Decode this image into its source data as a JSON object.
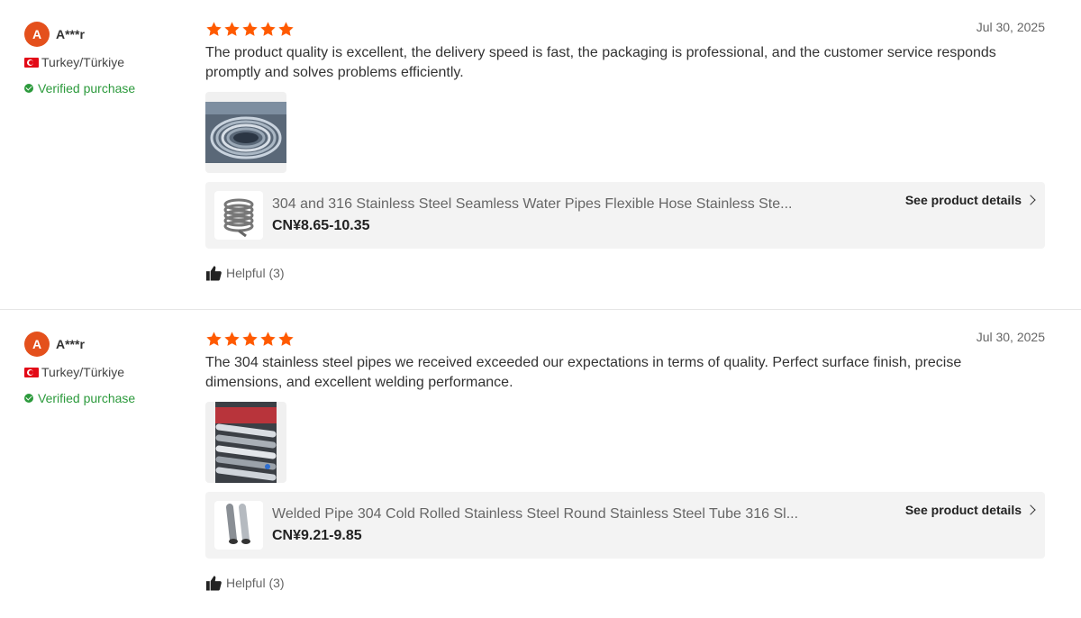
{
  "colors": {
    "star": "#ff5a00",
    "verified": "#2c9a3c",
    "avatar": "#e4501c"
  },
  "reviews": [
    {
      "avatar_letter": "A",
      "username": "A***r",
      "country": "Turkey/Türkiye",
      "verified_label": "Verified purchase",
      "rating": 5,
      "date": "Jul 30, 2025",
      "text": "The product quality is excellent, the delivery speed is fast, the packaging is professional, and the customer service responds promptly and solves problems efficiently.",
      "photo_icon": "coiled-steel-pipe-photo",
      "product": {
        "title": "304 and 316 Stainless Steel Seamless Water Pipes Flexible Hose Stainless Ste...",
        "price": "CN¥8.65-10.35",
        "details_label": "See product details",
        "thumb_icon": "coiled-hose-thumbnail"
      },
      "helpful_label": "Helpful (3)"
    },
    {
      "avatar_letter": "A",
      "username": "A***r",
      "country": "Turkey/Türkiye",
      "verified_label": "Verified purchase",
      "rating": 5,
      "date": "Jul 30, 2025",
      "text": "The 304 stainless steel pipes we received exceeded our expectations in terms of quality. Perfect surface finish, precise dimensions, and excellent welding performance.",
      "photo_icon": "steel-tubes-photo",
      "product": {
        "title": "Welded Pipe 304 Cold Rolled Stainless Steel Round Stainless Steel Tube 316 Sl...",
        "price": "CN¥9.21-9.85",
        "details_label": "See product details",
        "thumb_icon": "steel-tubes-thumbnail"
      },
      "helpful_label": "Helpful (3)"
    }
  ]
}
